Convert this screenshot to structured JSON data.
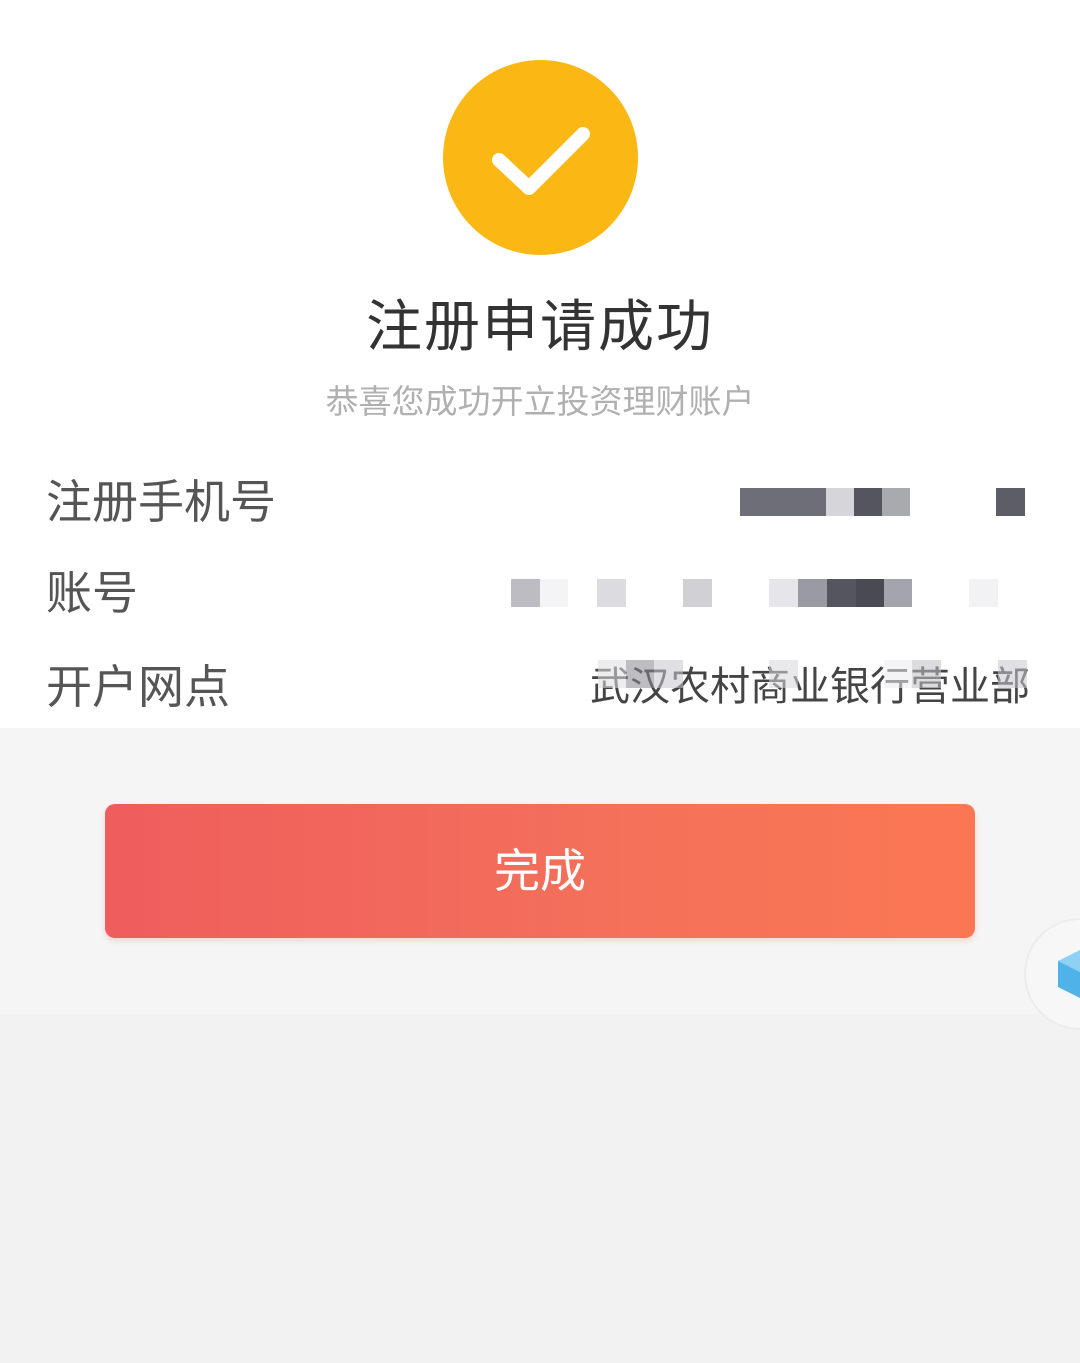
{
  "result": {
    "title": "注册申请成功",
    "subtitle": "恭喜您成功开立投资理财账户"
  },
  "info": {
    "phone": {
      "label": "注册手机号"
    },
    "account": {
      "label": "账号"
    },
    "branch": {
      "label": "开户网点",
      "value": "武汉农村商业银行营业部"
    }
  },
  "actions": {
    "done_label": "完成"
  },
  "icons": {
    "success": "checkmark-circle-icon",
    "floating": "cube-icon"
  },
  "colors": {
    "success": "#fbb713",
    "button_start": "#ef5d5d",
    "button_end": "#fb7753"
  }
}
